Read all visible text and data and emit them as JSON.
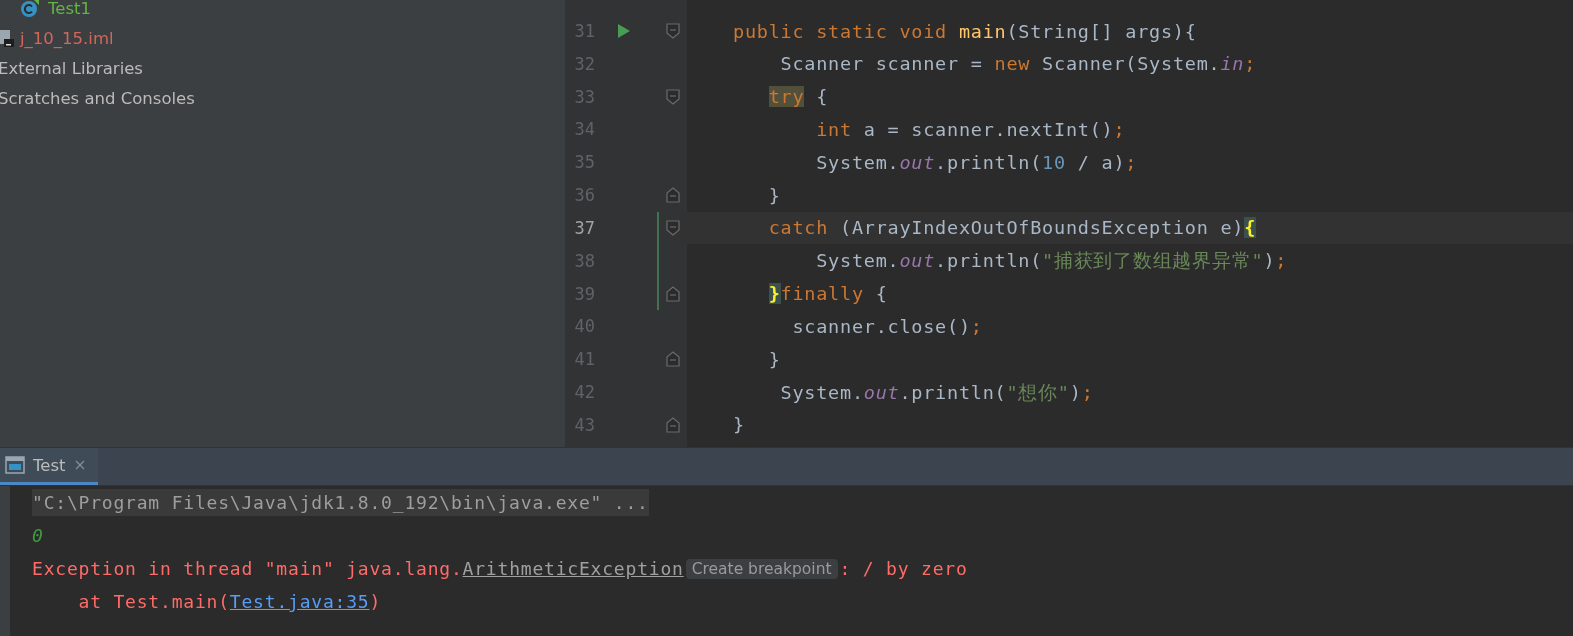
{
  "project_tree": {
    "items": [
      {
        "label": "Test1",
        "kind": "class",
        "color": "#62b543"
      },
      {
        "label": "j_10_15.iml",
        "kind": "module_file",
        "color": "#d1675a"
      },
      {
        "label": "External Libraries",
        "kind": "plain",
        "color": "#bbbbbb"
      },
      {
        "label": "Scratches and Consoles",
        "kind": "plain",
        "color": "#bbbbbb"
      }
    ]
  },
  "editor": {
    "lines": [
      {
        "number": "31",
        "current": false,
        "changed": false,
        "run": true,
        "fold_start": true,
        "fold_end": false,
        "tokens": [
          {
            "text": "public static void ",
            "kind": "kw"
          },
          {
            "text": "main",
            "kind": "method"
          },
          {
            "text": "(String[] args){",
            "kind": "plain"
          }
        ]
      },
      {
        "number": "32",
        "current": false,
        "changed": false,
        "run": false,
        "fold_start": false,
        "fold_end": false,
        "tokens": [
          {
            "text": "    Scanner scanner = ",
            "kind": "plain"
          },
          {
            "text": "new",
            "kind": "kw"
          },
          {
            "text": " Scanner(System.",
            "kind": "plain"
          },
          {
            "text": "in",
            "kind": "field"
          },
          {
            "text": ";",
            "kind": "kw"
          }
        ]
      },
      {
        "number": "33",
        "current": false,
        "changed": false,
        "run": false,
        "fold_start": true,
        "fold_end": false,
        "tokens": [
          {
            "text": "   try",
            "kind": "kw_match"
          },
          {
            "text": " {",
            "kind": "plain"
          }
        ]
      },
      {
        "number": "34",
        "current": false,
        "changed": false,
        "run": false,
        "fold_start": false,
        "fold_end": false,
        "tokens": [
          {
            "text": "       int",
            "kind": "kw"
          },
          {
            "text": " a = scanner.nextInt()",
            "kind": "plain"
          },
          {
            "text": ";",
            "kind": "kw"
          }
        ]
      },
      {
        "number": "35",
        "current": false,
        "changed": false,
        "run": false,
        "fold_start": false,
        "fold_end": false,
        "tokens": [
          {
            "text": "       System.",
            "kind": "plain"
          },
          {
            "text": "out",
            "kind": "field"
          },
          {
            "text": ".println(",
            "kind": "plain"
          },
          {
            "text": "10",
            "kind": "num"
          },
          {
            "text": " / a)",
            "kind": "plain"
          },
          {
            "text": ";",
            "kind": "kw"
          }
        ]
      },
      {
        "number": "36",
        "current": false,
        "changed": false,
        "run": false,
        "fold_start": false,
        "fold_end": true,
        "tokens": [
          {
            "text": "   }",
            "kind": "plain"
          }
        ]
      },
      {
        "number": "37",
        "current": true,
        "changed": true,
        "run": false,
        "fold_start": true,
        "fold_end": false,
        "tokens": [
          {
            "text": "   catch",
            "kind": "kw"
          },
          {
            "text": " (ArrayIndexOutOfBoundsException e)",
            "kind": "plain"
          },
          {
            "text": "{",
            "kind": "brace_match"
          }
        ]
      },
      {
        "number": "38",
        "current": false,
        "changed": true,
        "run": false,
        "fold_start": false,
        "fold_end": false,
        "tokens": [
          {
            "text": "       System.",
            "kind": "plain"
          },
          {
            "text": "out",
            "kind": "field"
          },
          {
            "text": ".println(",
            "kind": "plain"
          },
          {
            "text": "\"捕获到了数组越界异常\"",
            "kind": "str"
          },
          {
            "text": ")",
            "kind": "plain"
          },
          {
            "text": ";",
            "kind": "kw"
          }
        ]
      },
      {
        "number": "39",
        "current": false,
        "changed": true,
        "run": false,
        "fold_start": false,
        "fold_end": true,
        "tokens": [
          {
            "text": "   }",
            "kind": "brace_match"
          },
          {
            "text": "finally",
            "kind": "kw"
          },
          {
            "text": " {",
            "kind": "plain"
          }
        ]
      },
      {
        "number": "40",
        "current": false,
        "changed": false,
        "run": false,
        "fold_start": false,
        "fold_end": false,
        "tokens": [
          {
            "text": "     scanner.close()",
            "kind": "plain"
          },
          {
            "text": ";",
            "kind": "kw"
          }
        ]
      },
      {
        "number": "41",
        "current": false,
        "changed": false,
        "run": false,
        "fold_start": false,
        "fold_end": true,
        "tokens": [
          {
            "text": "   }",
            "kind": "plain"
          }
        ]
      },
      {
        "number": "42",
        "current": false,
        "changed": false,
        "run": false,
        "fold_start": false,
        "fold_end": false,
        "tokens": [
          {
            "text": "    System.",
            "kind": "plain"
          },
          {
            "text": "out",
            "kind": "field"
          },
          {
            "text": ".println(",
            "kind": "plain"
          },
          {
            "text": "\"想你\"",
            "kind": "str"
          },
          {
            "text": ")",
            "kind": "plain"
          },
          {
            "text": ";",
            "kind": "kw"
          }
        ]
      },
      {
        "number": "43",
        "current": false,
        "changed": false,
        "run": false,
        "fold_start": false,
        "fold_end": true,
        "tokens": [
          {
            "text": "}",
            "kind": "plain"
          }
        ]
      }
    ]
  },
  "run_panel": {
    "tabs": [
      {
        "label": "Test",
        "selected": true
      }
    ],
    "lines": [
      {
        "kind": "command",
        "segments": [
          {
            "text": "\"C:\\Program Files\\Java\\jdk1.8.0_192\\bin\\java.exe\" ...",
            "kind": "plain"
          }
        ]
      },
      {
        "kind": "output",
        "segments": [
          {
            "text": "0",
            "kind": "plain"
          }
        ]
      },
      {
        "kind": "error",
        "segments": [
          {
            "text": "Exception in thread \"main\" java.lang.",
            "kind": "plain"
          },
          {
            "text": "ArithmeticException",
            "kind": "class_link"
          },
          {
            "text": "Create breakpoint",
            "kind": "tooltip"
          },
          {
            "text": ": / by zero",
            "kind": "plain"
          }
        ]
      },
      {
        "kind": "error",
        "segments": [
          {
            "text": "    at Test.main(",
            "kind": "plain"
          },
          {
            "text": "Test.java:35",
            "kind": "file_link"
          },
          {
            "text": ")",
            "kind": "plain"
          }
        ]
      }
    ]
  }
}
